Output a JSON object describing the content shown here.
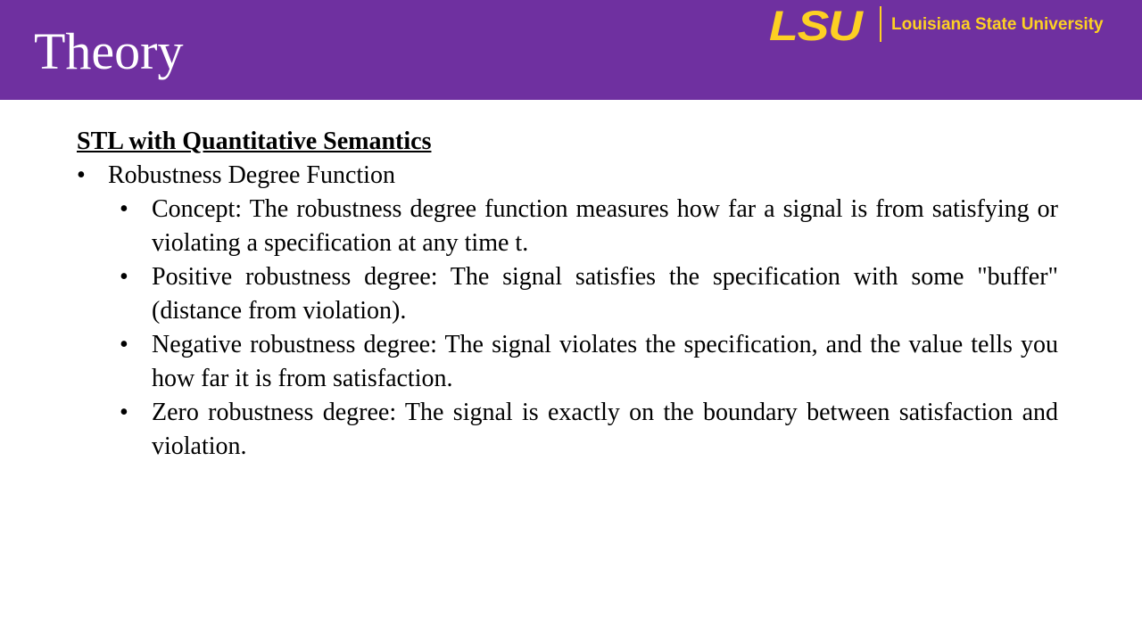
{
  "slide": {
    "title": "Theory",
    "colors": {
      "header": "#6f30a0",
      "logo_gold": "#fdd023",
      "text": "#000000"
    }
  },
  "logo": {
    "mark": "LSU",
    "name": "Louisiana State University"
  },
  "content": {
    "heading": "STL with Quantitative Semantics",
    "bullet_glyph": "•",
    "items": [
      {
        "label": "Robustness Degree Function",
        "subitems": [
          "Concept: The robustness degree function measures how far a signal is from satisfying or violating a specification at any time t.",
          "Positive robustness degree: The signal satisfies the specification with some \"buffer\" (distance from violation).",
          "Negative robustness degree: The signal violates the specification, and the value tells you how far it is from satisfaction.",
          "Zero robustness degree: The signal is exactly on the boundary between satisfaction and violation."
        ]
      }
    ]
  }
}
